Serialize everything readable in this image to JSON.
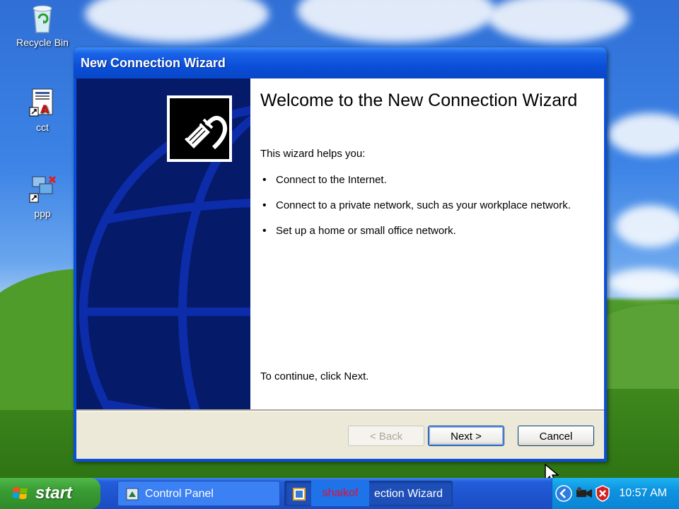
{
  "desktop": {
    "icons": [
      {
        "label": "Recycle Bin"
      },
      {
        "label": "cct"
      },
      {
        "label": "ppp"
      }
    ]
  },
  "window": {
    "title": "New Connection Wizard",
    "heading": "Welcome to the New Connection Wizard",
    "intro": "This wizard helps you:",
    "bullets": [
      "Connect to the Internet.",
      "Connect to a private network, such as your workplace network.",
      "Set up a home or small office network."
    ],
    "continue_text": "To continue, click Next.",
    "buttons": {
      "back": "< Back",
      "next": "Next >",
      "cancel": "Cancel"
    }
  },
  "taskbar": {
    "start_label": "start",
    "items": [
      {
        "label": "Control Panel"
      },
      {
        "label": "ection Wizard"
      }
    ],
    "overlay_text": "shaikof",
    "clock": "10:57 AM"
  }
}
